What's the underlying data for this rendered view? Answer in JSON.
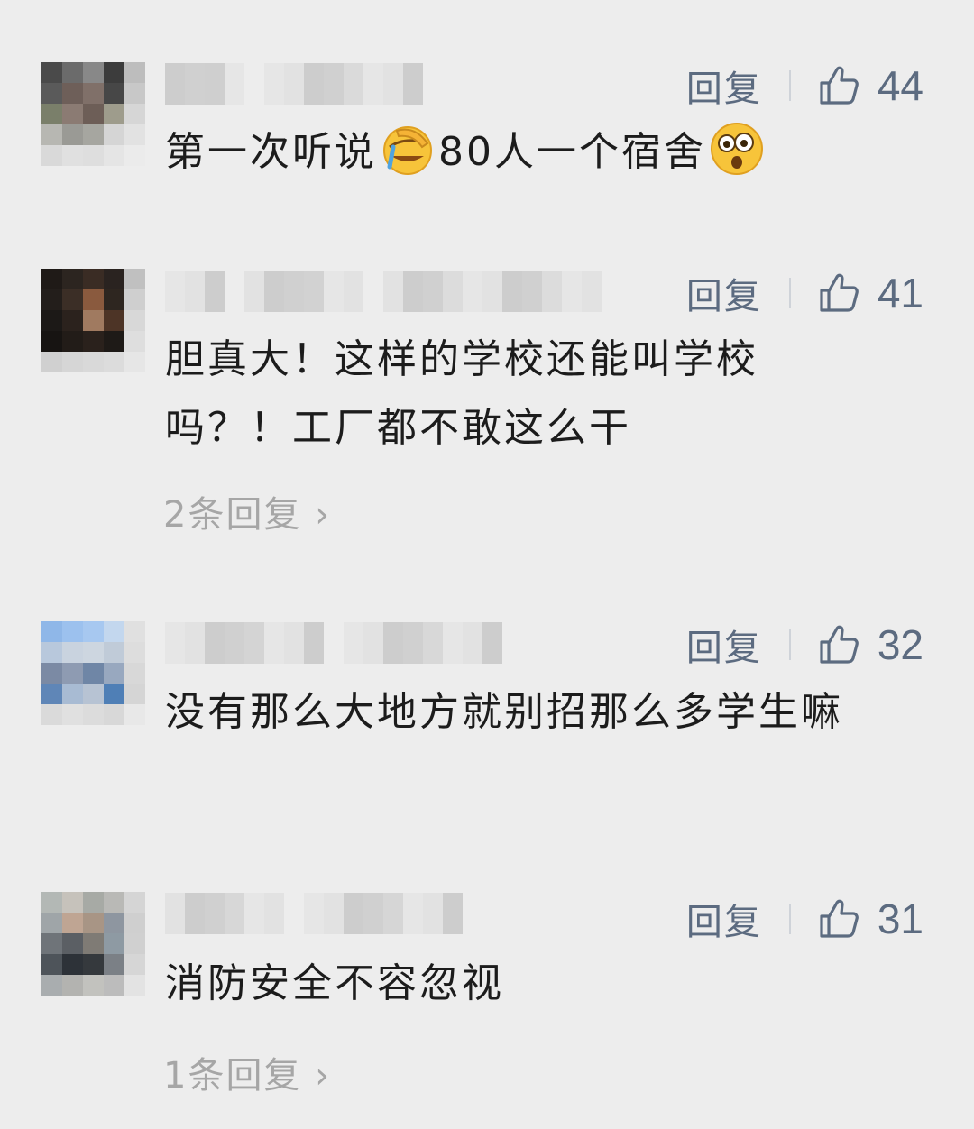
{
  "comments": [
    {
      "reply_label": "回复",
      "likes": "44",
      "text_parts": [
        "第一次听说",
        "80人一个宿舍"
      ],
      "emoji_1": "facepalm-crying-emoji",
      "emoji_2": "shocked-emoji",
      "avatar_colors": [
        "#4a4a4a",
        "#6b6b6b",
        "#888",
        "#3c3c3c",
        "#bdbdbd",
        "#5a5a5a",
        "#6e5f59",
        "#807069",
        "#474747",
        "#c8c8c8",
        "#7a7f6a",
        "#8b7b73",
        "#6d5e57",
        "#9e9c8c",
        "#d6d6d6",
        "#b7b7b2",
        "#9a9a95",
        "#a6a6a0",
        "#d5d5d5",
        "#e2e2e2",
        "#d9d9d9",
        "#e0e0e0",
        "#dedede",
        "#e5e5e5",
        "#ebebeb"
      ]
    },
    {
      "reply_label": "回复",
      "likes": "41",
      "text": "胆真大！这样的学校还能叫学校吗？！工厂都不敢这么干",
      "more_replies": "2条回复",
      "avatar_colors": [
        "#1f1a17",
        "#2c2520",
        "#3a2c24",
        "#2a2320",
        "#c0c0c0",
        "#231e1b",
        "#3b2e26",
        "#8a5a3e",
        "#2e2620",
        "#cfcfcf",
        "#1c1917",
        "#2b221d",
        "#a07a60",
        "#4d3426",
        "#d8d8d8",
        "#171412",
        "#221c18",
        "#2a211c",
        "#1e1a17",
        "#dedede",
        "#d0d0d0",
        "#d6d6d6",
        "#d9d9d9",
        "#dcdcdc",
        "#e6e6e6"
      ]
    },
    {
      "reply_label": "回复",
      "likes": "32",
      "text": "没有那么大地方就别招那么多学生嘛",
      "avatar_colors": [
        "#8fb7e8",
        "#9cc1ee",
        "#a7c8f0",
        "#c3d7ee",
        "#e0e0e0",
        "#b8c8dc",
        "#c9d3df",
        "#cdd6e0",
        "#c0cbd8",
        "#dddddd",
        "#7b8aa4",
        "#8e9bb2",
        "#6f86a6",
        "#98a8bf",
        "#d8d8d8",
        "#5f86b7",
        "#a8bbd3",
        "#b7c3d3",
        "#4f7fb6",
        "#d5d5d5",
        "#dadada",
        "#e0e0e0",
        "#dcdcdc",
        "#d8d8d8",
        "#e8e8e8"
      ]
    },
    {
      "reply_label": "回复",
      "likes": "31",
      "text": "消防安全不容忽视",
      "more_replies": "1条回复",
      "avatar_colors": [
        "#b3b8b5",
        "#c6c2bb",
        "#a7aaa5",
        "#b9b9b6",
        "#d5d5d5",
        "#9fa5a8",
        "#bfa593",
        "#a89585",
        "#8e96a0",
        "#cfcfcf",
        "#6f7479",
        "#5b5f64",
        "#7f7b75",
        "#8e9aa3",
        "#d0d0d0",
        "#4e545a",
        "#2d3238",
        "#35393d",
        "#7b8086",
        "#d6d6d6",
        "#a9adaf",
        "#b3b3b0",
        "#c2c2be",
        "#bcbcbc",
        "#e3e3e3"
      ]
    }
  ],
  "colors": {
    "background": "#ededed",
    "action_text": "#5c6b80",
    "comment_text": "#1c1c1c",
    "more_replies_text": "#a6a6a6"
  },
  "icons": {
    "like": "thumbs-up-outline-icon",
    "chevron": "chevron-right-icon"
  }
}
